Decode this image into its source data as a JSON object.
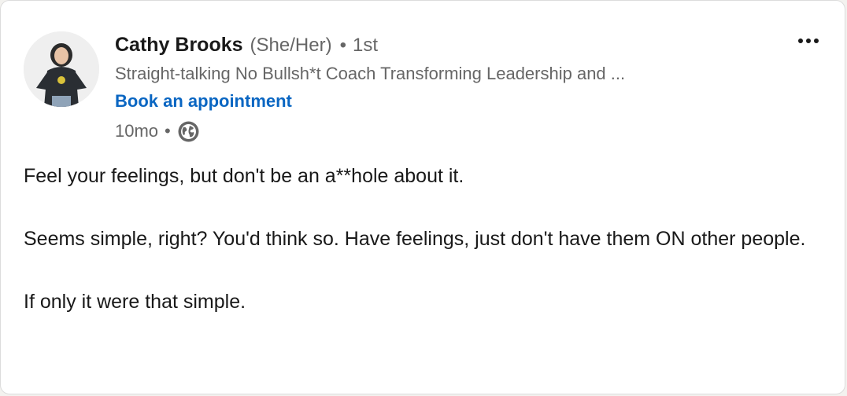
{
  "author": {
    "name": "Cathy Brooks",
    "pronouns": "(She/Her)",
    "separator": "•",
    "connection_degree": "1st",
    "headline": "Straight-talking No Bullsh*t Coach Transforming Leadership and ...",
    "cta_label": "Book an appointment",
    "avatar_icon": "person-photo-avatar"
  },
  "meta": {
    "time_ago": "10mo",
    "separator": "•",
    "visibility_icon": "globe-icon"
  },
  "menu": {
    "more_icon": "ellipsis-icon"
  },
  "post": {
    "paragraphs": [
      "Feel your feelings, but don't be an a**hole about it.",
      "Seems simple, right? You'd think so. Have feelings, just don't have them ON other people.",
      "If only it were that simple."
    ]
  },
  "colors": {
    "link": "#0a66c2",
    "primary_text": "#191919",
    "secondary_text": "#666666",
    "card_background": "#ffffff"
  }
}
